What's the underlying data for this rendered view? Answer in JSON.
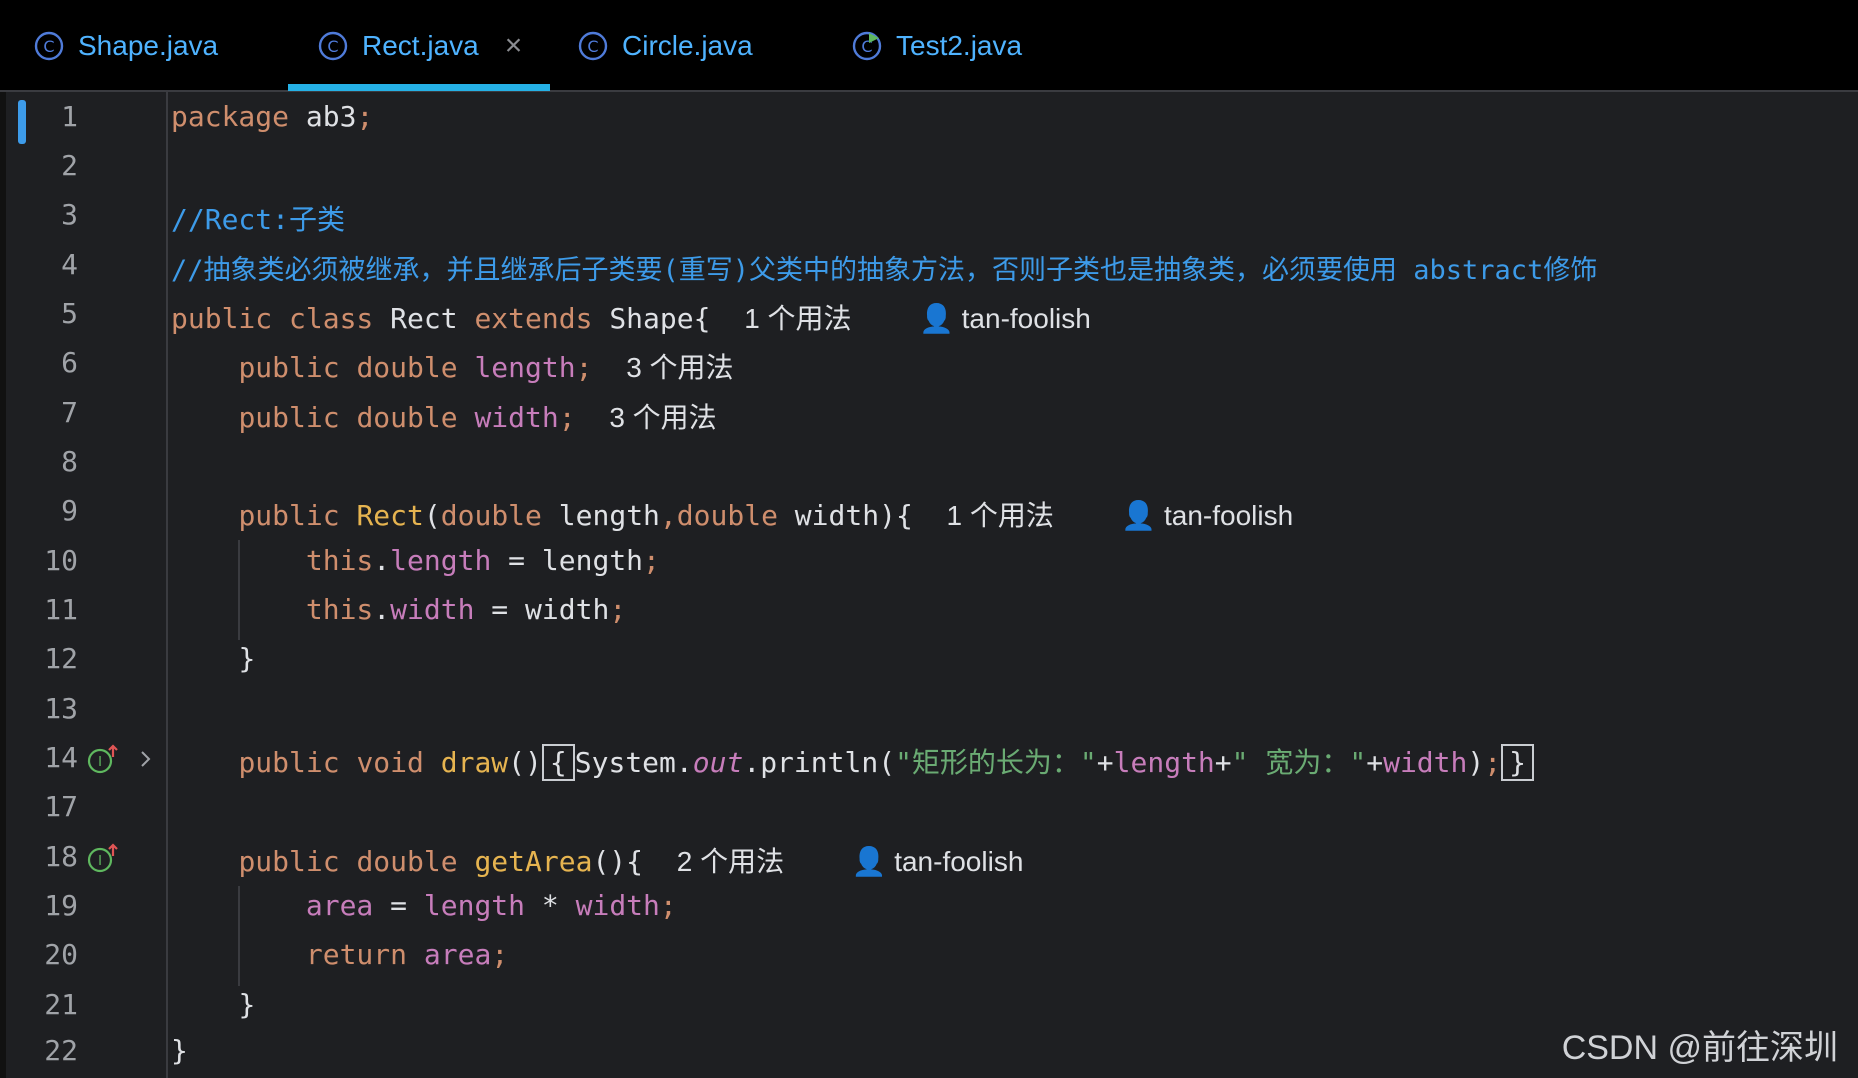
{
  "tabs": [
    {
      "label": "Shape.java",
      "active": false
    },
    {
      "label": "Rect.java",
      "active": true,
      "close": "×"
    },
    {
      "label": "Circle.java",
      "active": false
    },
    {
      "label": "Test2.java",
      "active": false
    }
  ],
  "lines": [
    {
      "n": "1"
    },
    {
      "n": "2"
    },
    {
      "n": "3"
    },
    {
      "n": "4"
    },
    {
      "n": "5"
    },
    {
      "n": "6"
    },
    {
      "n": "7"
    },
    {
      "n": "8"
    },
    {
      "n": "9"
    },
    {
      "n": "10"
    },
    {
      "n": "11"
    },
    {
      "n": "12"
    },
    {
      "n": "13"
    },
    {
      "n": "14"
    },
    {
      "n": "17"
    },
    {
      "n": "18"
    },
    {
      "n": "19"
    },
    {
      "n": "20"
    },
    {
      "n": "21"
    },
    {
      "n": "22"
    }
  ],
  "code": {
    "l1_kw": "package",
    "l1_rest": " ab3",
    "l1_semi": ";",
    "l3_comment": "//Rect:子类",
    "l4_comment": "//抽象类必须被继承，并且继承后子类要(重写)父类中的抽象方法，否则子类也是抽象类，必须要使用 abstract修饰",
    "l5_kw": "public class",
    "l5_name": " Rect ",
    "l5_kw2": "extends",
    "l5_rest": " Shape{",
    "l5_usage": "1 个用法",
    "l5_author": "tan-foolish",
    "l6_kw": "public double",
    "l6_field": " length",
    "l6_semi": ";",
    "l6_usage": "3 个用法",
    "l7_kw": "public double",
    "l7_field": " width",
    "l7_semi": ";",
    "l7_usage": "3 个用法",
    "l9_kw": "public",
    "l9_fn": " Rect",
    "l9_p1": "(",
    "l9_kw2": "double",
    "l9_p2": " length",
    "l9_comma": ",",
    "l9_kw3": "double",
    "l9_p3": " width){",
    "l9_usage": "1 个用法",
    "l9_author": "tan-foolish",
    "l10_kw": "this",
    "l10_dot": ".",
    "l10_field": "length",
    "l10_rest": " = length",
    "l10_semi": ";",
    "l11_kw": "this",
    "l11_dot": ".",
    "l11_field": "width",
    "l11_rest": " = width",
    "l11_semi": ";",
    "l12": "}",
    "l14_kw": "public void",
    "l14_fn": " draw",
    "l14_par": "()",
    "l14_open": "{",
    "l14_sys": "System.",
    "l14_out": "out",
    "l14_print": ".println(",
    "l14_str1": "\"矩形的长为：\"",
    "l14_plus1": "+",
    "l14_field1": "length",
    "l14_plus2": "+",
    "l14_str2": "\" 宽为：\"",
    "l14_plus3": "+",
    "l14_field2": "width",
    "l14_close": ")",
    "l14_semi": ";",
    "l14_end": "}",
    "l18_kw": "public double",
    "l18_fn": " getArea",
    "l18_rest": "(){",
    "l18_usage": "2 个用法",
    "l18_author": "tan-foolish",
    "l19_f1": "area",
    "l19_eq": " = ",
    "l19_f2": "length",
    "l19_op": " * ",
    "l19_f3": "width",
    "l19_semi": ";",
    "l20_kw": "return",
    "l20_field": " area",
    "l20_semi": ";",
    "l21": "}",
    "l22": "}"
  },
  "watermark": "CSDN @前往深圳",
  "icons": {
    "tab_class_icon": "class-c-icon",
    "tab_runnable_icon": "runnable-class-icon",
    "implements_icon": "implements-up-icon",
    "fold_icon": "chevron-right-icon",
    "user_icon": "user-icon"
  },
  "colors": {
    "background": "#1e1f22",
    "tab_bar": "#000000",
    "tab_text": "#4fb3ff",
    "active_underline": "#25b1e6",
    "keyword": "#cf8e6d",
    "comment": "#3d9be9",
    "field": "#c77dbb",
    "function": "#56a8f5",
    "declaration": "#e6b450",
    "string": "#6aab73"
  }
}
